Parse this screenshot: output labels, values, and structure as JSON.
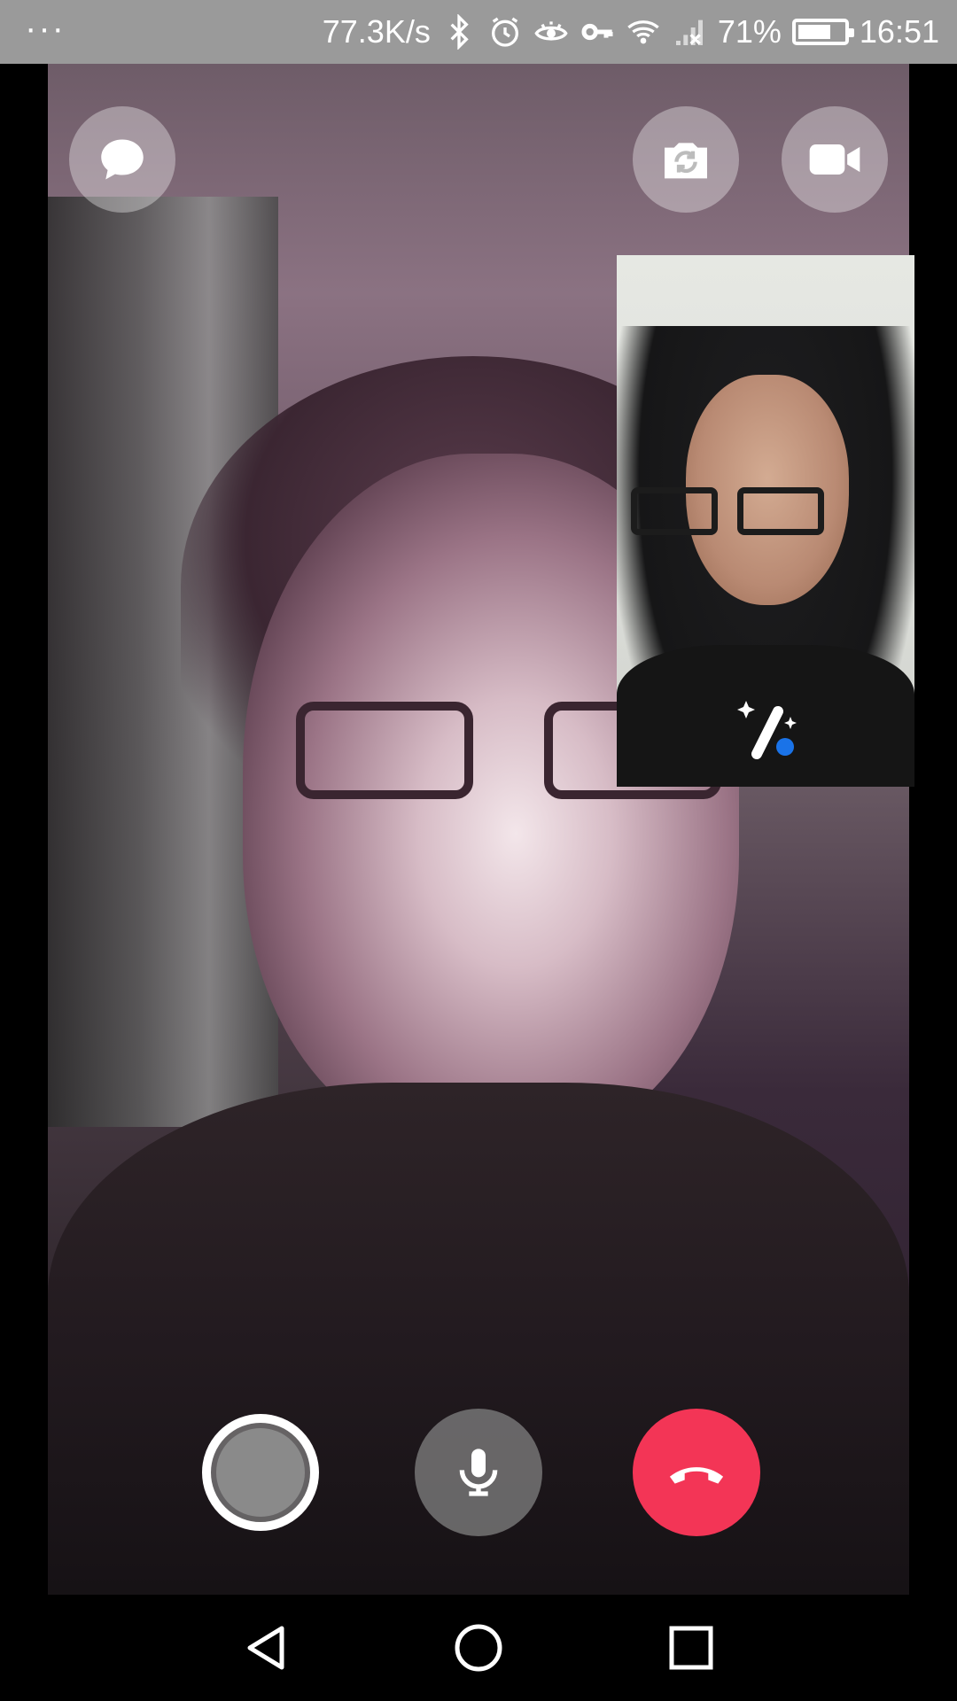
{
  "status_bar": {
    "more": "···",
    "net_speed": "77.3K/s",
    "battery_percent": "71%",
    "battery_level": 0.71,
    "time": "16:51",
    "icons": [
      "bluetooth-icon",
      "alarm-icon",
      "eye-icon",
      "key-icon",
      "wifi-icon",
      "signal-icon",
      "battery-icon"
    ]
  },
  "call": {
    "top_controls": [
      "chat-icon",
      "flip-camera-icon",
      "video-camera-icon"
    ],
    "bottom_controls": [
      "capture-button",
      "microphone-icon",
      "end-call-icon"
    ],
    "self_preview_overlay": "effects-wand-icon"
  },
  "colors": {
    "status_bar_bg": "#9a9a9a",
    "end_call": "#f33556",
    "effects_dot": "#1a73e8"
  },
  "nav_bar": {
    "buttons": [
      "back-icon",
      "home-icon",
      "recents-icon"
    ]
  }
}
